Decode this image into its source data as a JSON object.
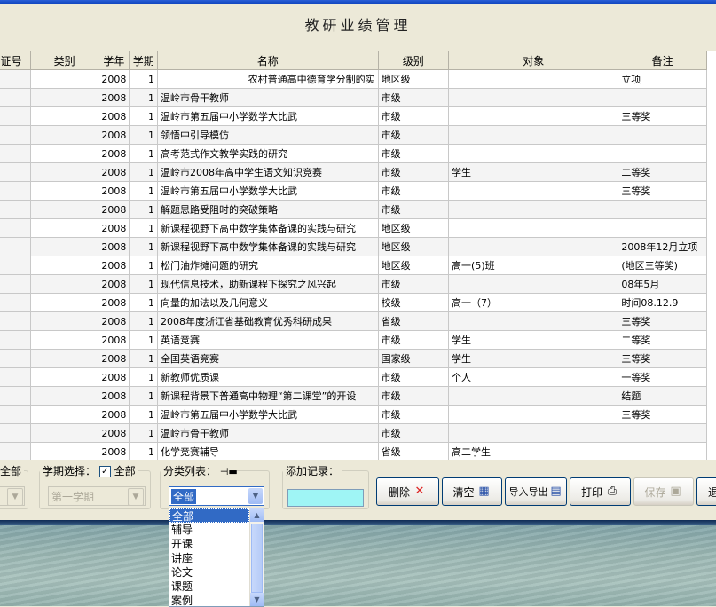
{
  "app_title": "教研业绩管理",
  "columns": [
    "证号",
    "类别",
    "学年",
    "学期",
    "名称",
    "级别",
    "对象",
    "备注"
  ],
  "rows": [
    {
      "year": "2008",
      "term": "1",
      "name": "农村普通高中德育学分制的实",
      "level": "地区级",
      "target": "",
      "remark": "立项"
    },
    {
      "year": "2008",
      "term": "1",
      "name": "温岭市骨干教师",
      "level": "市级",
      "target": "",
      "remark": ""
    },
    {
      "year": "2008",
      "term": "1",
      "name": "温岭市第五届中小学数学大比武",
      "level": "市级",
      "target": "",
      "remark": "三等奖"
    },
    {
      "year": "2008",
      "term": "1",
      "name": "领悟中引导模仿",
      "level": "市级",
      "target": "",
      "remark": ""
    },
    {
      "year": "2008",
      "term": "1",
      "name": "高考范式作文教学实践的研究",
      "level": "市级",
      "target": "",
      "remark": ""
    },
    {
      "year": "2008",
      "term": "1",
      "name": "温岭市2008年高中学生语文知识竞赛",
      "level": "市级",
      "target": "学生",
      "remark": "二等奖"
    },
    {
      "year": "2008",
      "term": "1",
      "name": "温岭市第五届中小学数学大比武",
      "level": "市级",
      "target": "",
      "remark": "三等奖"
    },
    {
      "year": "2008",
      "term": "1",
      "name": "解题思路受阻时的突破策略",
      "level": "市级",
      "target": "",
      "remark": ""
    },
    {
      "year": "2008",
      "term": "1",
      "name": "新课程视野下高中数学集体备课的实践与研究",
      "level": "地区级",
      "target": "",
      "remark": ""
    },
    {
      "year": "2008",
      "term": "1",
      "name": "新课程视野下高中数学集体备课的实践与研究",
      "level": "地区级",
      "target": "",
      "remark": "2008年12月立项"
    },
    {
      "year": "2008",
      "term": "1",
      "name": "松门油炸摊问题的研究",
      "level": "地区级",
      "target": "高一(5)班",
      "remark": "(地区三等奖)"
    },
    {
      "year": "2008",
      "term": "1",
      "name": "现代信息技术，助新课程下探究之风兴起",
      "level": "市级",
      "target": "",
      "remark": "08年5月"
    },
    {
      "year": "2008",
      "term": "1",
      "name": "向量的加法以及几何意义",
      "level": "校级",
      "target": "高一（7）",
      "remark": "时间08.12.9"
    },
    {
      "year": "2008",
      "term": "1",
      "name": "2008年度浙江省基础教育优秀科研成果",
      "level": "省级",
      "target": "",
      "remark": "三等奖"
    },
    {
      "year": "2008",
      "term": "1",
      "name": "英语竞赛",
      "level": "市级",
      "target": "学生",
      "remark": "二等奖"
    },
    {
      "year": "2008",
      "term": "1",
      "name": "全国英语竞赛",
      "level": "国家级",
      "target": "学生",
      "remark": "三等奖"
    },
    {
      "year": "2008",
      "term": "1",
      "name": "新教师优质课",
      "level": "市级",
      "target": "个人",
      "remark": "一等奖"
    },
    {
      "year": "2008",
      "term": "1",
      "name": "新课程背景下普通高中物理“第二课堂”的开设",
      "level": "市级",
      "target": "",
      "remark": "结题"
    },
    {
      "year": "2008",
      "term": "1",
      "name": "温岭市第五届中小学数学大比武",
      "level": "市级",
      "target": "",
      "remark": "三等奖"
    },
    {
      "year": "2008",
      "term": "1",
      "name": "温岭市骨干教师",
      "level": "市级",
      "target": "",
      "remark": ""
    },
    {
      "year": "2008",
      "term": "1",
      "name": "化学竞赛辅导",
      "level": "省级",
      "target": "高二学生",
      "remark": ""
    }
  ],
  "filters": {
    "all_left": "全部",
    "term_legend": "学期选择：",
    "term_all_label": "全部",
    "term_value": "第一学期",
    "category_legend": "分类列表：",
    "category_value": "全部",
    "add_legend": "添加记录："
  },
  "buttons": {
    "delete": "删除",
    "clear": "清空",
    "import_export": "导入导出",
    "print": "打印",
    "save": "保存",
    "exit": "退"
  },
  "dropdown_options": [
    "全部",
    "辅导",
    "开课",
    "讲座",
    "论文",
    "课题",
    "案例"
  ],
  "colors": {
    "selection": "#316ac5",
    "add_field": "#9ff5f5"
  }
}
